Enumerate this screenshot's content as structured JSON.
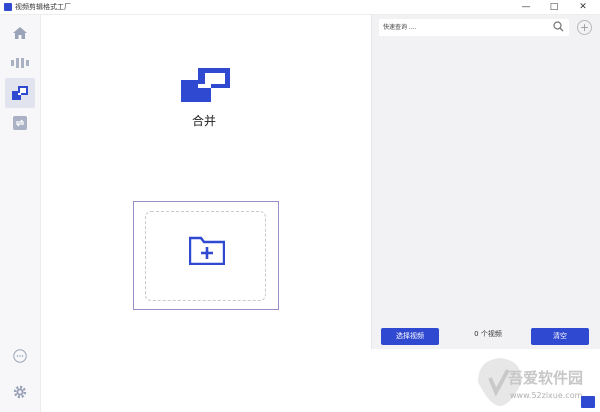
{
  "window": {
    "title": "视频剪辑格式工厂",
    "minimize_glyph": "—",
    "maximize_glyph": "□",
    "close_glyph": "✕"
  },
  "sidebar": {
    "items": [
      {
        "name": "home",
        "icon": "home-icon",
        "active": false
      },
      {
        "name": "split",
        "icon": "split-icon",
        "active": false
      },
      {
        "name": "merge",
        "icon": "merge-icon",
        "active": true
      },
      {
        "name": "convert",
        "icon": "convert-icon",
        "active": false
      }
    ],
    "bottom_items": [
      {
        "name": "more",
        "icon": "more-icon"
      },
      {
        "name": "settings",
        "icon": "gear-icon"
      }
    ]
  },
  "main": {
    "title": "合并",
    "dropzone_icon": "folder-add-icon"
  },
  "panel": {
    "search_placeholder": "快速查询 ....",
    "add_glyph": "+",
    "select_button": "选择视频",
    "count_text": "0 个视频",
    "clear_button": "清空"
  },
  "watermark": {
    "text": "吾爱软件园",
    "url": "www.52zixue.com"
  },
  "colors": {
    "accent": "#2f49d1",
    "sidebar_bg": "#f7f7f9",
    "panel_bg": "#f2f2f4",
    "dropzone_border": "#9b8bc6"
  }
}
